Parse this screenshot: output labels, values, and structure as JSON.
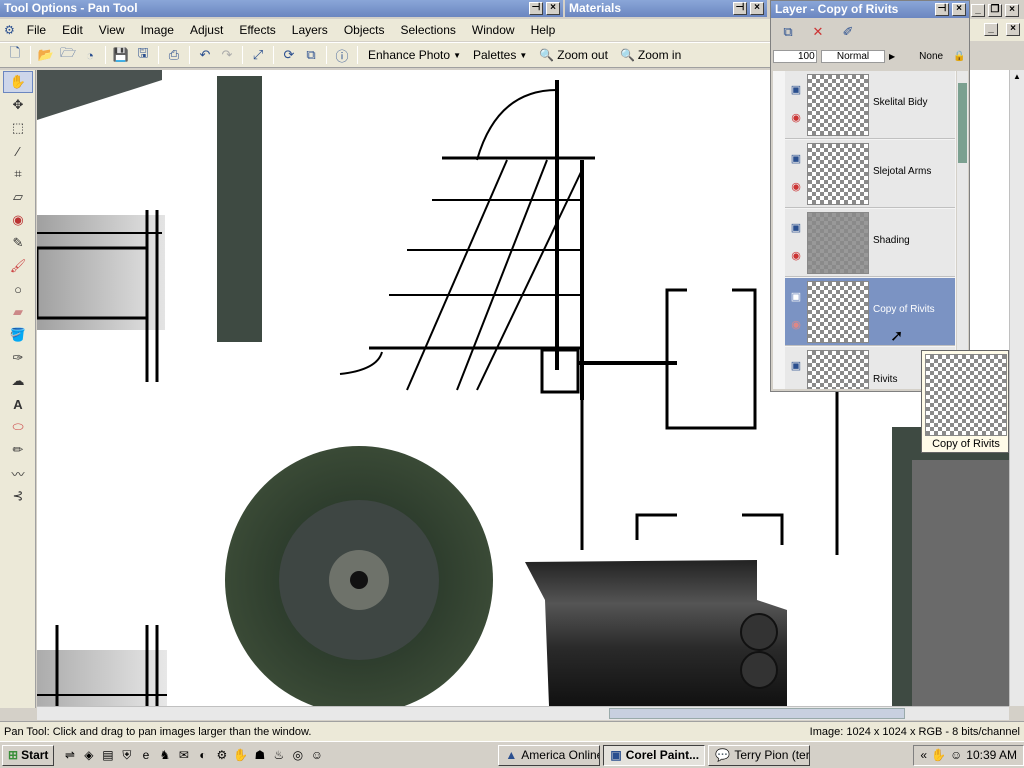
{
  "tool_options": {
    "title": "Tool Options - Pan Tool"
  },
  "materials": {
    "title": "Materials"
  },
  "menu": [
    "File",
    "Edit",
    "View",
    "Image",
    "Adjust",
    "Effects",
    "Layers",
    "Objects",
    "Selections",
    "Window",
    "Help"
  ],
  "toolbar": {
    "enhance_photo": "Enhance Photo",
    "palettes": "Palettes",
    "zoom_out": "Zoom out",
    "zoom_in": "Zoom in"
  },
  "layers_palette": {
    "title": "Layer - Copy of Rivits",
    "opacity": "100",
    "blend_mode": "Normal",
    "mask": "None",
    "layers": [
      {
        "name": "Skelital Bidy",
        "selected": false
      },
      {
        "name": "Slejotal Arms",
        "selected": false
      },
      {
        "name": "Shading",
        "selected": false
      },
      {
        "name": "Copy of Rivits",
        "selected": true
      },
      {
        "name": "Rivits",
        "selected": false
      }
    ]
  },
  "tooltip": {
    "label": "Copy of Rivits"
  },
  "status": {
    "hint": "Pan Tool: Click and drag to pan images larger than the window.",
    "image_info": "Image:  1024 x 1024 x RGB - 8 bits/channel"
  },
  "taskbar": {
    "start": "Start",
    "tasks": [
      {
        "label": "America  Online",
        "active": false
      },
      {
        "label": "Corel Paint...",
        "active": true
      },
      {
        "label": "Terry Pion (ter...",
        "active": false
      }
    ],
    "time": "10:39 AM",
    "chevron": "«"
  },
  "colors": {
    "accent": "#6b86c0",
    "selected_layer": "#7b93c3",
    "canvas": "#ffffff",
    "desktop": "#d4d0c8"
  }
}
